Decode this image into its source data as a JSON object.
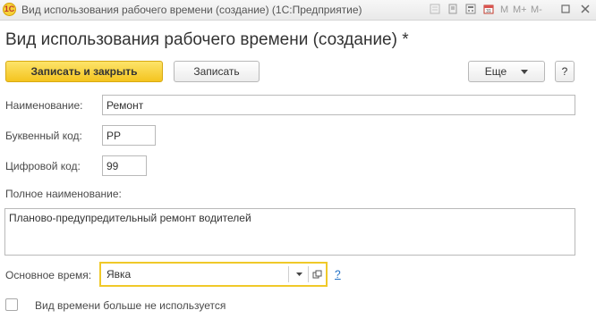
{
  "window": {
    "title": "Вид использования рабочего времени (создание)  (1С:Предприятие)",
    "tools": [
      "M",
      "M+",
      "M-"
    ]
  },
  "form": {
    "title": "Вид использования рабочего времени (создание) *"
  },
  "toolbar": {
    "save_close_label": "Записать и закрыть",
    "save_label": "Записать",
    "more_label": "Еще",
    "help_label": "?"
  },
  "fields": {
    "name_label": "Наименование:",
    "name_value": "Ремонт",
    "letter_code_label": "Буквенный код:",
    "letter_code_value": "РР",
    "digit_code_label": "Цифровой код:",
    "digit_code_value": "99",
    "full_name_label": "Полное наименование:",
    "full_name_value": "Планово-предупредительный ремонт водителей",
    "main_time_label": "Основное время:",
    "main_time_value": "Явка",
    "main_time_help": "?",
    "not_used_label": "Вид времени больше не используется"
  },
  "colors": {
    "primary_button": "#f4c41f",
    "focus_border": "#f0c929",
    "link": "#1f6fc5"
  }
}
